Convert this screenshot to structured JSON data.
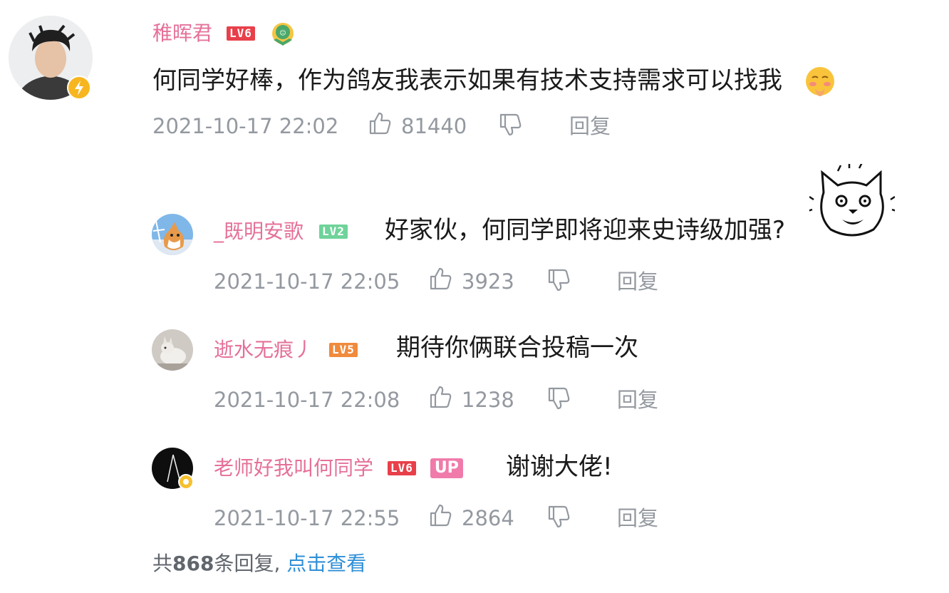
{
  "main_comment": {
    "username": "稚晖君",
    "level": "LV6",
    "content": "何同学好棒，作为鸽友我表示如果有技术支持需求可以找我",
    "timestamp": "2021-10-17 22:02",
    "likes": "81440",
    "reply_label": "回复"
  },
  "replies": [
    {
      "username": "_既明安歌",
      "level": "LV2",
      "content": "好家伙，何同学即将迎来史诗级加强?",
      "timestamp": "2021-10-17 22:05",
      "likes": "3923",
      "reply_label": "回复"
    },
    {
      "username": "逝水无痕丿",
      "level": "LV5",
      "content": "期待你俩联合投稿一次",
      "timestamp": "2021-10-17 22:08",
      "likes": "1238",
      "reply_label": "回复"
    },
    {
      "username": "老师好我叫何同学",
      "level": "LV6",
      "badge": "UP",
      "content": "谢谢大佬!",
      "timestamp": "2021-10-17 22:55",
      "likes": "2864",
      "reply_label": "回复"
    }
  ],
  "footer": {
    "prefix": "共",
    "count": "868",
    "suffix": "条回复,",
    "link": "点击查看"
  },
  "colors": {
    "username": "#e5709a",
    "lv6": "#e8404a",
    "lv5": "#f08a3c",
    "lv2": "#6fd39a",
    "meta": "#9499a0",
    "link": "#2f8fd7"
  },
  "icons": [
    "lightning-badge-icon",
    "fan-medal-icon",
    "thumbs-up-icon",
    "thumbs-down-icon",
    "blush-emoji-icon",
    "cat-sticker-icon"
  ]
}
